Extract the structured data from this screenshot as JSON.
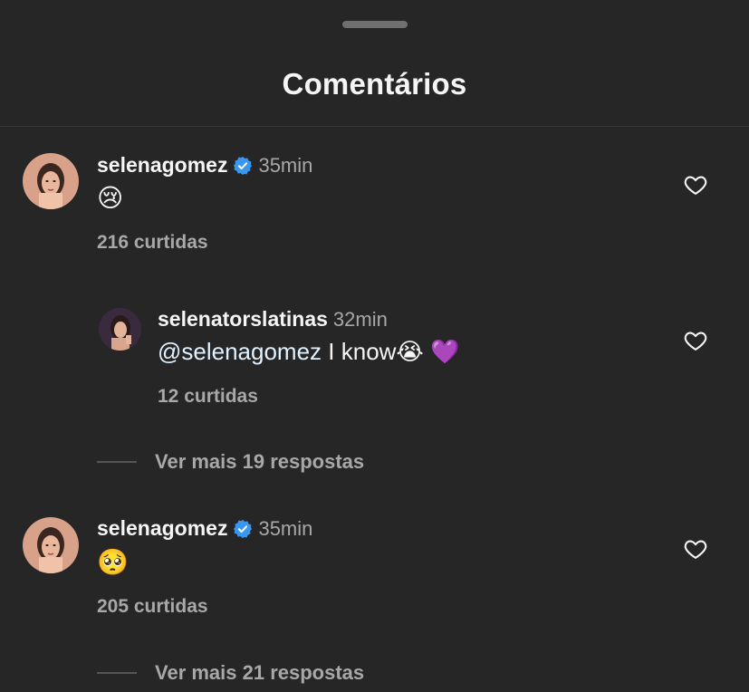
{
  "sheet": {
    "title": "Comentários"
  },
  "colors": {
    "background": "#262626",
    "text_primary": "#f5f5f5",
    "text_secondary": "#a8a8a8",
    "verified_badge": "#3897f0",
    "divider": "#3a3a3a"
  },
  "comments": [
    {
      "username": "selenagomez",
      "verified": true,
      "time": "35min",
      "text": "😢",
      "likes": "216 curtidas",
      "icon": "heart-outline-icon"
    },
    {
      "username": "selenatorslatinas",
      "verified": false,
      "time": "32min",
      "mention": "@selenagomez",
      "text": " I know😭 💜",
      "likes": "12 curtidas",
      "icon": "heart-outline-icon",
      "is_reply": true
    },
    {
      "username": "selenagomez",
      "verified": true,
      "time": "35min",
      "text": "🥺",
      "likes": "205 curtidas",
      "icon": "heart-outline-icon"
    }
  ],
  "more_replies": [
    {
      "label": "Ver mais 19 respostas"
    },
    {
      "label": "Ver mais 21 respostas"
    }
  ]
}
